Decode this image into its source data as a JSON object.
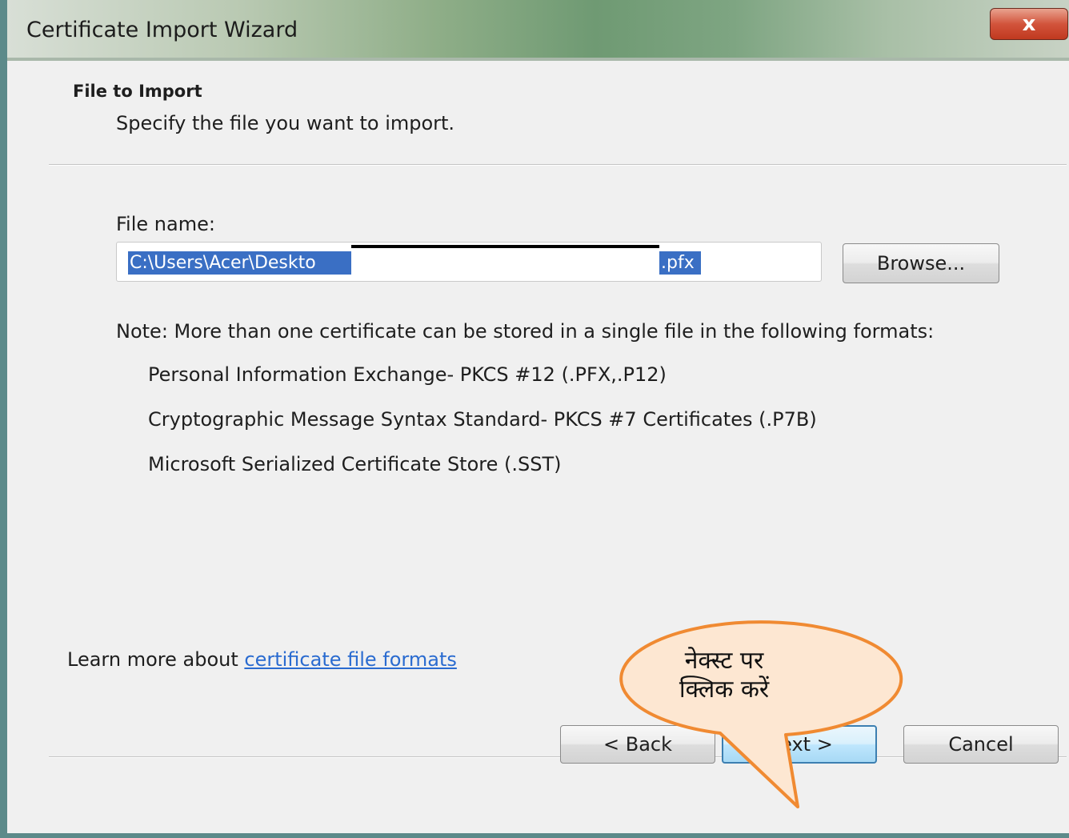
{
  "window": {
    "title": "Certificate Import Wizard",
    "close_label": "x"
  },
  "header": {
    "title": "File to Import",
    "subtitle": "Specify the file you want to import."
  },
  "file": {
    "label": "File name:",
    "value_start": "C:\\Users\\Acer\\Deskto",
    "value_end": ".pfx",
    "browse_label": "Browse..."
  },
  "note": {
    "text": "Note:  More than one certificate can be stored in a single file in the following formats:",
    "formats": [
      "Personal Information Exchange- PKCS #12 (.PFX,.P12)",
      "Cryptographic Message Syntax Standard- PKCS #7 Certificates (.P7B)",
      "Microsoft Serialized Certificate Store (.SST)"
    ]
  },
  "learn_more": {
    "prefix": "Learn more about ",
    "link": "certificate file formats"
  },
  "footer": {
    "back_label": "< Back",
    "next_label": "Next >",
    "cancel_label": "Cancel"
  },
  "callout": {
    "text": "नेक्स्ट पर\nक्लिक करें",
    "fill": "#fde7d2",
    "stroke": "#f08a32"
  },
  "colors": {
    "selection": "#3a6fc4",
    "link": "#2a6bd0",
    "next_border": "#3c7fb1"
  }
}
